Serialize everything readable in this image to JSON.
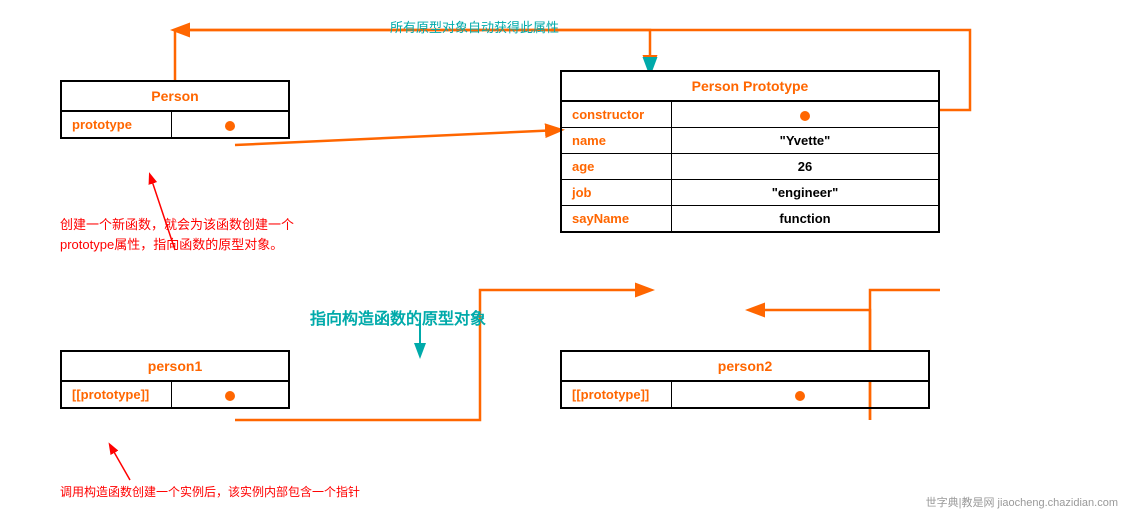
{
  "person_box": {
    "title": "Person",
    "row1_label": "prototype",
    "row1_value": ""
  },
  "prototype_box": {
    "title": "Person Prototype",
    "rows": [
      {
        "label": "constructor",
        "value": ""
      },
      {
        "label": "name",
        "value": "\"Yvette\""
      },
      {
        "label": "age",
        "value": "26"
      },
      {
        "label": "job",
        "value": "\"engineer\""
      },
      {
        "label": "sayName",
        "value": "function"
      }
    ]
  },
  "person1_box": {
    "title": "person1",
    "row1_label": "[[prototype]]",
    "row1_value": ""
  },
  "person2_box": {
    "title": "person2",
    "row1_label": "[[prototype]]",
    "row1_value": ""
  },
  "annotations": {
    "top_label": "所有原型对象自动获得此属性",
    "left_label_line1": "创建一个新函数，就会为该函数创建一个",
    "left_label_line2": "prototype属性，指向函数的原型对象。",
    "middle_label": "指向构造函数的原型对象",
    "bottom_label": "调用构造函数创建一个实例后，该实例内部包含一个指针"
  },
  "watermark": "世字典|教是网  jiaocheng.chazidian.com"
}
